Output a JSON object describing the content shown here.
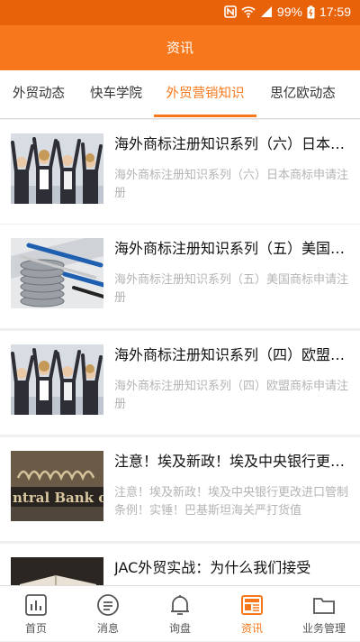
{
  "status_bar": {
    "battery": "99%",
    "time": "17:59",
    "icons": [
      "nfc-icon",
      "wifi-icon",
      "signal-icon",
      "battery-icon"
    ]
  },
  "header": {
    "title": "资讯"
  },
  "tabs": [
    {
      "label": "外贸动态",
      "active": false
    },
    {
      "label": "快车学院",
      "active": false
    },
    {
      "label": "外贸营销知识",
      "active": true
    },
    {
      "label": "思亿欧动态",
      "active": false
    }
  ],
  "articles": [
    {
      "title": "海外商标注册知识系列（六）日本商标申请注册",
      "desc": "海外商标注册知识系列（六）日本商标申请注册",
      "image": "team-celebration"
    },
    {
      "title": "海外商标注册知识系列（五）美国商标申请注册",
      "desc": "海外商标注册知识系列（五）美国商标申请注册",
      "image": "coins-and-pens"
    },
    {
      "title": "海外商标注册知识系列（四）欧盟商标申请注册",
      "desc": "海外商标注册知识系列（四）欧盟商标申请注册",
      "image": "team-celebration"
    },
    {
      "title": "注意！埃及新政！埃及中央银行更改进口管制条例！",
      "desc": "注意！埃及新政！埃及中央银行更改进口管制条例！实锤！巴基斯坦海关严打货值",
      "image": "central-bank-building"
    },
    {
      "title": "JAC外贸实战：为什么我们接受",
      "desc": "",
      "image": "open-book"
    }
  ],
  "tabbar": [
    {
      "label": "首页",
      "icon": "chart-icon",
      "active": false
    },
    {
      "label": "消息",
      "icon": "message-icon",
      "active": false
    },
    {
      "label": "询盘",
      "icon": "bell-icon",
      "active": false
    },
    {
      "label": "资讯",
      "icon": "news-icon",
      "active": true
    },
    {
      "label": "业务管理",
      "icon": "folder-icon",
      "active": false
    }
  ],
  "colors": {
    "accent": "#f7781c",
    "status_bar": "#e8620a"
  }
}
